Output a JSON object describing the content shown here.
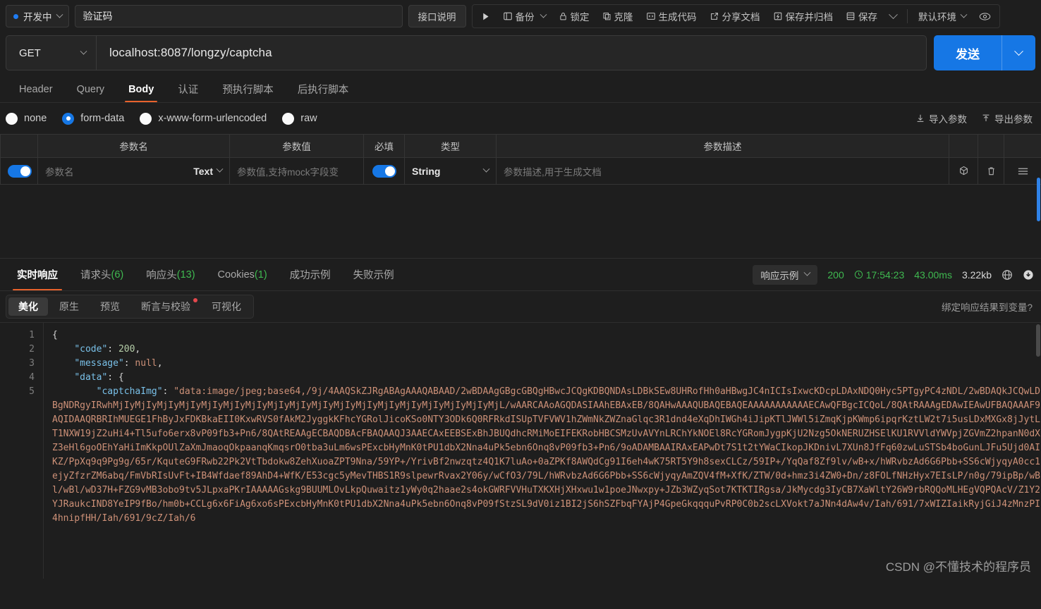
{
  "topbar": {
    "status_label": "开发中",
    "api_name": "验证码",
    "doc_button": "接口说明",
    "run_icon": "play-icon",
    "items": [
      {
        "label": "备份",
        "icon": "backup-icon",
        "has_chevron": true
      },
      {
        "label": "锁定",
        "icon": "lock-icon",
        "has_chevron": false
      },
      {
        "label": "克隆",
        "icon": "clone-icon",
        "has_chevron": false
      },
      {
        "label": "生成代码",
        "icon": "code-icon",
        "has_chevron": false
      },
      {
        "label": "分享文档",
        "icon": "share-icon",
        "has_chevron": false
      },
      {
        "label": "保存并归档",
        "icon": "archive-icon",
        "has_chevron": false
      },
      {
        "label": "保存",
        "icon": "save-icon",
        "has_chevron": true
      }
    ],
    "env_label": "默认环境",
    "eye_icon": "eye-icon"
  },
  "url_bar": {
    "method": "GET",
    "url": "localhost:8087/longzy/captcha",
    "send_label": "发送"
  },
  "request_tabs": [
    {
      "label": "Header",
      "active": false
    },
    {
      "label": "Query",
      "active": false
    },
    {
      "label": "Body",
      "active": true
    },
    {
      "label": "认证",
      "active": false
    },
    {
      "label": "预执行脚本",
      "active": false
    },
    {
      "label": "后执行脚本",
      "active": false
    }
  ],
  "body_types": [
    {
      "label": "none",
      "selected": false
    },
    {
      "label": "form-data",
      "selected": true
    },
    {
      "label": "x-www-form-urlencoded",
      "selected": false
    },
    {
      "label": "raw",
      "selected": false
    }
  ],
  "body_actions": [
    {
      "label": "导入参数",
      "icon": "import-icon"
    },
    {
      "label": "导出参数",
      "icon": "export-icon"
    }
  ],
  "param_table": {
    "headers": [
      "",
      "参数名",
      "参数值",
      "必填",
      "类型",
      "参数描述",
      "",
      "",
      ""
    ],
    "rows": [
      {
        "enabled": true,
        "name_placeholder": "参数名",
        "name_type": "Text",
        "value_placeholder": "参数值,支持mock字段变",
        "required": true,
        "type": "String",
        "desc_placeholder": "参数描述,用于生成文档",
        "actions": [
          "cube-icon",
          "trash-icon",
          "menu-icon"
        ]
      }
    ]
  },
  "response_tabs": [
    {
      "label": "实时响应",
      "count": "",
      "active": true
    },
    {
      "label": "请求头",
      "count": "(6)",
      "active": false
    },
    {
      "label": "响应头",
      "count": "(13)",
      "active": false
    },
    {
      "label": "Cookies",
      "count": "(1)",
      "active": false
    },
    {
      "label": "成功示例",
      "count": "",
      "active": false
    },
    {
      "label": "失败示例",
      "count": "",
      "active": false
    }
  ],
  "response_status": {
    "example_select": "响应示例",
    "code": "200",
    "time": "17:54:23",
    "duration": "43.00ms",
    "size": "3.22kb",
    "globe_icon": "globe-icon",
    "download_icon": "download-icon"
  },
  "view_tabs": [
    {
      "label": "美化",
      "active": true,
      "badge": false
    },
    {
      "label": "原生",
      "active": false,
      "badge": false
    },
    {
      "label": "预览",
      "active": false,
      "badge": false
    },
    {
      "label": "断言与校验",
      "active": false,
      "badge": true
    },
    {
      "label": "可视化",
      "active": false,
      "badge": false
    }
  ],
  "bind_link": "绑定响应结果到变量?",
  "code": {
    "line_numbers": [
      "1",
      "2",
      "3",
      "4",
      "5"
    ],
    "json": {
      "code_key": "\"code\"",
      "code_value": "200",
      "message_key": "\"message\"",
      "message_value": "null",
      "data_key": "\"data\"",
      "captcha_key": "\"captchaImg\""
    },
    "base64_lines": [
      "\"data:image/jpeg;base64,/9j/4AAQSkZJRgABAgAAAQABAAD/2wBDAAgGBgcGBQgHBwcJCQgKDBQNDAsLDBkSEw8UHRofHh0aHBwgJC4nICIsIxwcKDcpLDAxNDQ0Hyc5PTgyPC4zNDL/",
      "2wBDAQkJCQwLDBgNDRgyIRwhMjIyMjIyMjIyMjIyMjIyMjIyMjIyMjIyMjIyMjIyMjIyMjIyMjIyMjIyMjIyMjIyMjIyMjL/wAARCAAoAGQDASIAAhEBAxEB/",
      "8QAHwAAAQUBAQEBAQEAAAAAAAAAAAECAwQFBgcICQoL/",
      "8QAtRAAAgEDAwIEAwUFBAQAAAF9AQIDAAQRBRIhMUEGE1FhByJxFDKBkaEII0KxwRVS0fAkM2JyggkKFhcYGRolJicoKSo0NTY3ODk6Q0RFRkdISUpTVFVWV1hZWmNkZWZnaGlqc3R1dnd4eXqDhIWGh4iJipKTlJWWl5iZmqKjpKWmp6ipqrKztLW2t7i5usLDxMXGx8jJytLT1NXW19jZ2uHi4+Tl5ufo6erx8vP09fb3+Pn6/",
      "8QAtREAAgECBAQDBAcFBAQAAQJ3AAECAxEEBSExBhJBUQdhcRMiMoEIFEKRobHBCSMzUvAVYnLRChYkNOEl8RcYGRomJygpKjU2Nzg5OkNERUZHSElKU1RVVldYWVpjZGVmZ2hpanN0dXZ3eHl6goOEhYaHiImKkpOUlZaXmJmaoqOkpaanqKmqsrO0tba3uLm6wsPExcbHyMnK0tPU1dbX2Nna4uPk5ebn6Onq8vP09fb3+Pn6/",
      "9oADAMBAAIRAxEAPwDt7S1t2tYWaCIkopJKDnivL7XUn8JfFq60zwLuSTSb4boGunLJFu5Ujd0AIKZ/PpXq9q9Pg9g/65r/KquteG9FRwb22Pk2VtTbdokw8ZehXuoaZPT9Nna/",
      "59YP+/YrivBf2nwzqtz4Q1K7luAo+0aZPKf8AWQdCg91I6eh4wK75RT5Y9h8sexCLCz/59IP+/YqQaf8Zf9lv/wB+x/hWRvbzAd6G6Pbb+SS6cWjyqyA0cc1ejyZfzrZM6abq/FmVbRIsUvFt+IB4Wfdaef89AhD4+WfK/",
      "E53cgc5yMevTHBS1R9slpewrRvax2Y06y/wCfO3/79L/hWRvbzAd6G6Pbb+SS6cWjyqyAmZQV4fM+XfK/ZTW/0d+hmz3i4ZW0+Dn/z8FOLfNHzHyx7EIsLP/n0g/79ipBp/wBl/wBl/wD37H+FZG9vMB3obo9tv5JLpxaPKrIAAAA",
      "AGskg9BUUMLOvLkpQuwaitz1yWy0q2haae2s4okGWRFVVHuTXKXHjXHxwu1w1poeJNwxpy+JZb3WZyqSot7KTKTIRgsa/",
      "JkMycdg3IyCB7XaWltY26W9rbRQQoMLHEgVQPQAcV/Z1Y2YJRaukcIND8YeIP9fBo/hm0b+CCLg6x6FiAg6xo6sPExcbHyMnK0tPU1dbX2Nna4uPk5ebn6Onq8vP09f",
      "StzSL9dV0iz1BI2jS6hSZFbqFYAjP4GpeGkqqquPvRP0C0b2scLXVokt7aJNn4dAw4v/Iah/691/7xWIZIaikRyjGiJ4zMnzPI4hnipfHH/Iah/691/9cZ/Iah/6"
    ],
    "watermark": "CSDN @不懂技术的程序员"
  },
  "colors": {
    "accent_blue": "#1677e5",
    "tab_underline": "#e8622c",
    "status_green": "#3fb950",
    "badge_red": "#e5484d",
    "background": "#1e1e1e"
  }
}
